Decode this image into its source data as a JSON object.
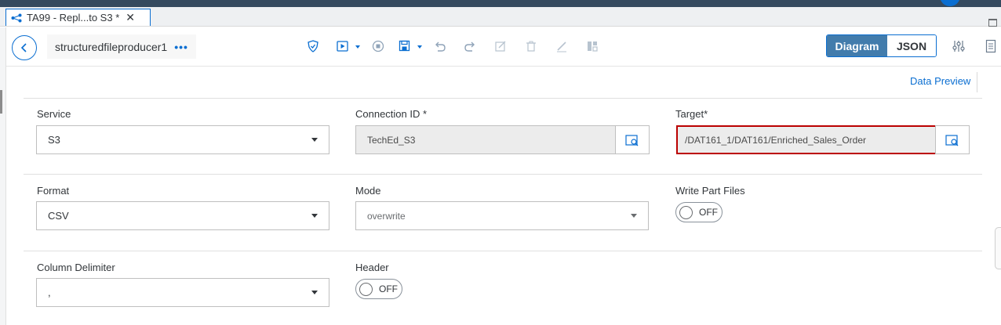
{
  "tab": {
    "title": "TA99 - Repl...to S3 *",
    "close": "✕",
    "icon": "graph-icon"
  },
  "toolbar": {
    "operator_name": "structuredfileproducer1",
    "more_label": "•••",
    "view_toggle": {
      "diagram": "Diagram",
      "json": "JSON",
      "selected": "Diagram"
    },
    "icons": [
      "shield-icon",
      "run-icon",
      "stop-icon",
      "save-icon",
      "undo-icon",
      "redo-icon",
      "edit-icon",
      "delete-icon",
      "pencil-icon",
      "layout-icon",
      "settings-icon",
      "document-icon"
    ]
  },
  "data_preview": "Data Preview",
  "form": {
    "service": {
      "label": "Service",
      "value": "S3"
    },
    "connection_id": {
      "label": "Connection ID *",
      "value": "TechEd_S3"
    },
    "target": {
      "label": "Target*",
      "value": "/DAT161_1/DAT161/Enriched_Sales_Order"
    },
    "format": {
      "label": "Format",
      "value": "CSV"
    },
    "mode": {
      "label": "Mode",
      "value": "overwrite"
    },
    "write_part_files": {
      "label": "Write Part Files",
      "value": "OFF"
    },
    "column_delimiter": {
      "label": "Column Delimiter",
      "value": ","
    },
    "header": {
      "label": "Header",
      "value": "OFF"
    }
  },
  "colors": {
    "accent": "#0a6ed1",
    "highlight": "#bb0000",
    "topbar": "#354a5f"
  }
}
